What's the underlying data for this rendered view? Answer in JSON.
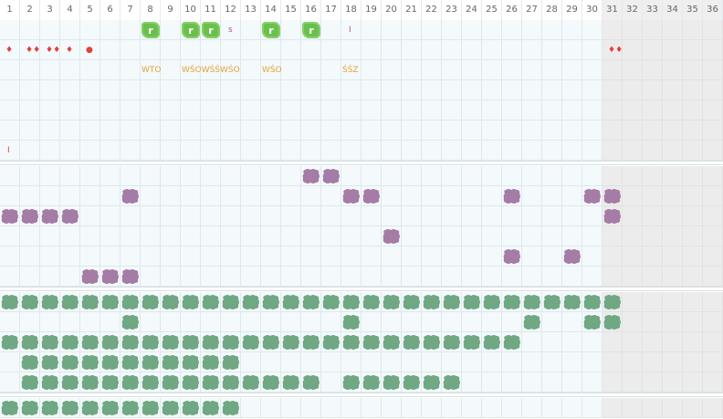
{
  "calendar": {
    "day_numbers": [
      "1",
      "2",
      "3",
      "4",
      "5",
      "6",
      "7",
      "8",
      "9",
      "10",
      "11",
      "12",
      "13",
      "14",
      "15",
      "16",
      "17",
      "18",
      "19",
      "20",
      "21",
      "22",
      "23",
      "24",
      "25",
      "26",
      "27",
      "28",
      "29",
      "30",
      "31",
      "32",
      "33",
      "34",
      "35",
      "36"
    ],
    "month_days": 30,
    "colors": {
      "cell_bg": "#f4f9fb",
      "grid_line": "#dde9ed",
      "out_of_month_bg": "#ececec",
      "green_letter": "#6bc04d",
      "purple_blob": "#a57ca6",
      "green_blob": "#6fa883",
      "red_drop": "#e2413e",
      "orange_text": "#e0a33a",
      "purple_text": "#9a5a9a"
    }
  },
  "sections": {
    "top": {
      "rows": 7,
      "letter_badges": [
        {
          "day": 8,
          "row": 0,
          "text": "r"
        },
        {
          "day": 10,
          "row": 0,
          "text": "r"
        },
        {
          "day": 11,
          "row": 0,
          "text": "r"
        },
        {
          "day": 14,
          "row": 0,
          "text": "r"
        },
        {
          "day": 16,
          "row": 0,
          "text": "r"
        }
      ],
      "small_marks": [
        {
          "day": 12,
          "row": 0,
          "text": "s",
          "color": "#9a5a9a"
        },
        {
          "day": 18,
          "row": 0,
          "text": "I",
          "color": "#9a5a9a"
        },
        {
          "day": 1,
          "row": 6,
          "text": "I",
          "color": "#e2413e"
        }
      ],
      "drops": [
        {
          "day": 1,
          "row": 1,
          "text": "♦"
        },
        {
          "day": 2,
          "row": 1,
          "text": "♦♦"
        },
        {
          "day": 3,
          "row": 1,
          "text": "♦♦"
        },
        {
          "day": 4,
          "row": 1,
          "text": "♦"
        },
        {
          "day": 5,
          "row": 1,
          "text": "●"
        },
        {
          "day": 31,
          "row": 1,
          "text": "♦♦"
        }
      ],
      "text_labels": [
        {
          "day": 8,
          "row": 2,
          "text": "WTO"
        },
        {
          "day": 10,
          "row": 2,
          "text": "WŚOWŚŚWŚO"
        },
        {
          "day": 14,
          "row": 2,
          "text": "WŚO"
        },
        {
          "day": 18,
          "row": 2,
          "text": "ŚŚZ"
        }
      ]
    },
    "purple": {
      "rows": 6,
      "cells": [
        [
          16,
          0
        ],
        [
          17,
          0
        ],
        [
          7,
          1
        ],
        [
          18,
          1
        ],
        [
          19,
          1
        ],
        [
          26,
          1
        ],
        [
          30,
          1
        ],
        [
          31,
          1
        ],
        [
          1,
          2
        ],
        [
          2,
          2
        ],
        [
          3,
          2
        ],
        [
          4,
          2
        ],
        [
          31,
          2
        ],
        [
          20,
          3
        ],
        [
          26,
          4
        ],
        [
          29,
          4
        ],
        [
          5,
          5
        ],
        [
          6,
          5
        ],
        [
          7,
          5
        ]
      ]
    },
    "green": {
      "rows": 5,
      "ranges": [
        {
          "row": 0,
          "from": 1,
          "to": 31
        },
        {
          "row": 1,
          "days": [
            7,
            18,
            27,
            30,
            31
          ]
        },
        {
          "row": 2,
          "from": 1,
          "to": 26
        },
        {
          "row": 3,
          "from": 2,
          "to": 12
        },
        {
          "row": 4,
          "from": 2,
          "to": 16
        },
        {
          "row": 4,
          "from": 18,
          "to": 23
        }
      ]
    },
    "bottom": {
      "rows": 1,
      "ranges": [
        {
          "row": 0,
          "from": 1,
          "to": 12
        }
      ]
    }
  }
}
